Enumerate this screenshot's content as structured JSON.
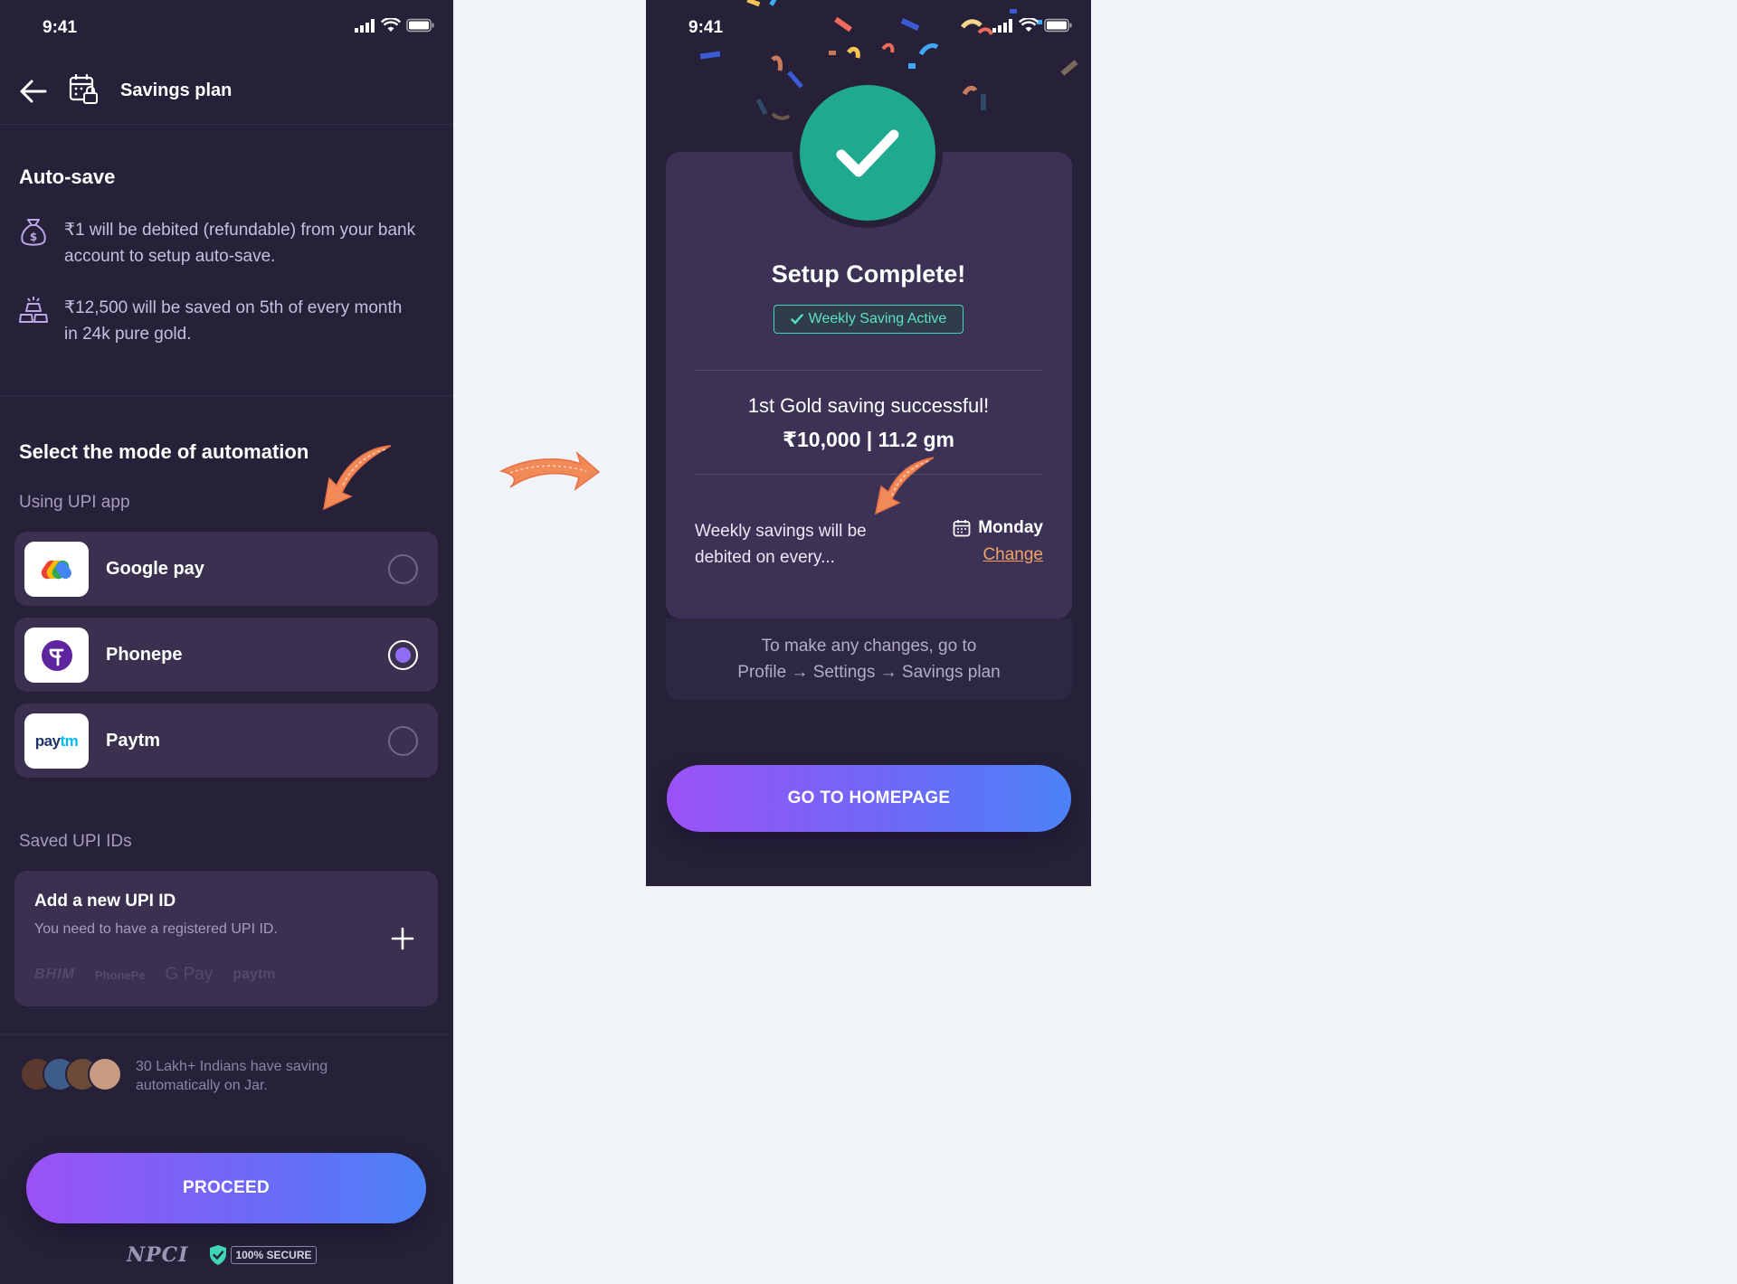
{
  "left_screen": {
    "status": {
      "time": "9:41"
    },
    "header": {
      "title": "Savings plan"
    },
    "autosave": {
      "title": "Auto-save",
      "points": [
        {
          "icon": "money-bag-icon",
          "text": "₹1 will be debited (refundable) from your bank account to setup auto-save."
        },
        {
          "icon": "gold-bars-icon",
          "text": "₹12,500 will be saved on 5th of every month in 24k pure gold."
        }
      ]
    },
    "automation": {
      "title": "Select the mode of automation",
      "subtitle": "Using UPI app",
      "options": [
        {
          "name": "Google pay",
          "icon": "google-pay-icon",
          "selected": false
        },
        {
          "name": "Phonepe",
          "icon": "phonepe-icon",
          "selected": true
        },
        {
          "name": "Paytm",
          "icon": "paytm-icon",
          "selected": false
        }
      ],
      "paytm_logo_text": {
        "pay": "pay",
        "tm": "tm"
      }
    },
    "saved_upi": {
      "label": "Saved UPI IDs",
      "add_title": "Add a new UPI ID",
      "add_subtitle": "You need to have a registered UPI ID.",
      "logos": [
        "BHIM",
        "PhonePe",
        "G Pay",
        "paytm"
      ]
    },
    "social_proof": {
      "text": "30 Lakh+ Indians have saving automatically on Jar."
    },
    "proceed_label": "PROCEED",
    "footer": {
      "npci": "NPCI",
      "secure": "100% SECURE"
    }
  },
  "right_screen": {
    "status": {
      "time": "9:41"
    },
    "title": "Setup Complete!",
    "badge": "Weekly Saving Active",
    "gold_success": "1st Gold saving successful!",
    "gold_amount": "₹10,000 | 11.2 gm",
    "weekly_text": "Weekly savings will be debited on every...",
    "day": "Monday",
    "change_label": "Change",
    "hint_line1": "To make any changes, go to",
    "hint_line2": "Profile → Settings → Savings plan",
    "homepage_label": "GO TO HOMEPAGE"
  },
  "colors": {
    "page_bg": "#f0f3f7",
    "phone_bg": "#262038",
    "card_bg": "#3a3150",
    "success_green": "#1fa98e",
    "accent_teal": "#3fd6b7",
    "link_orange": "#f4a268",
    "button_gradient": [
      "#9b52f6",
      "#4b82f6"
    ],
    "annotation_arrow": "#f28a57"
  }
}
